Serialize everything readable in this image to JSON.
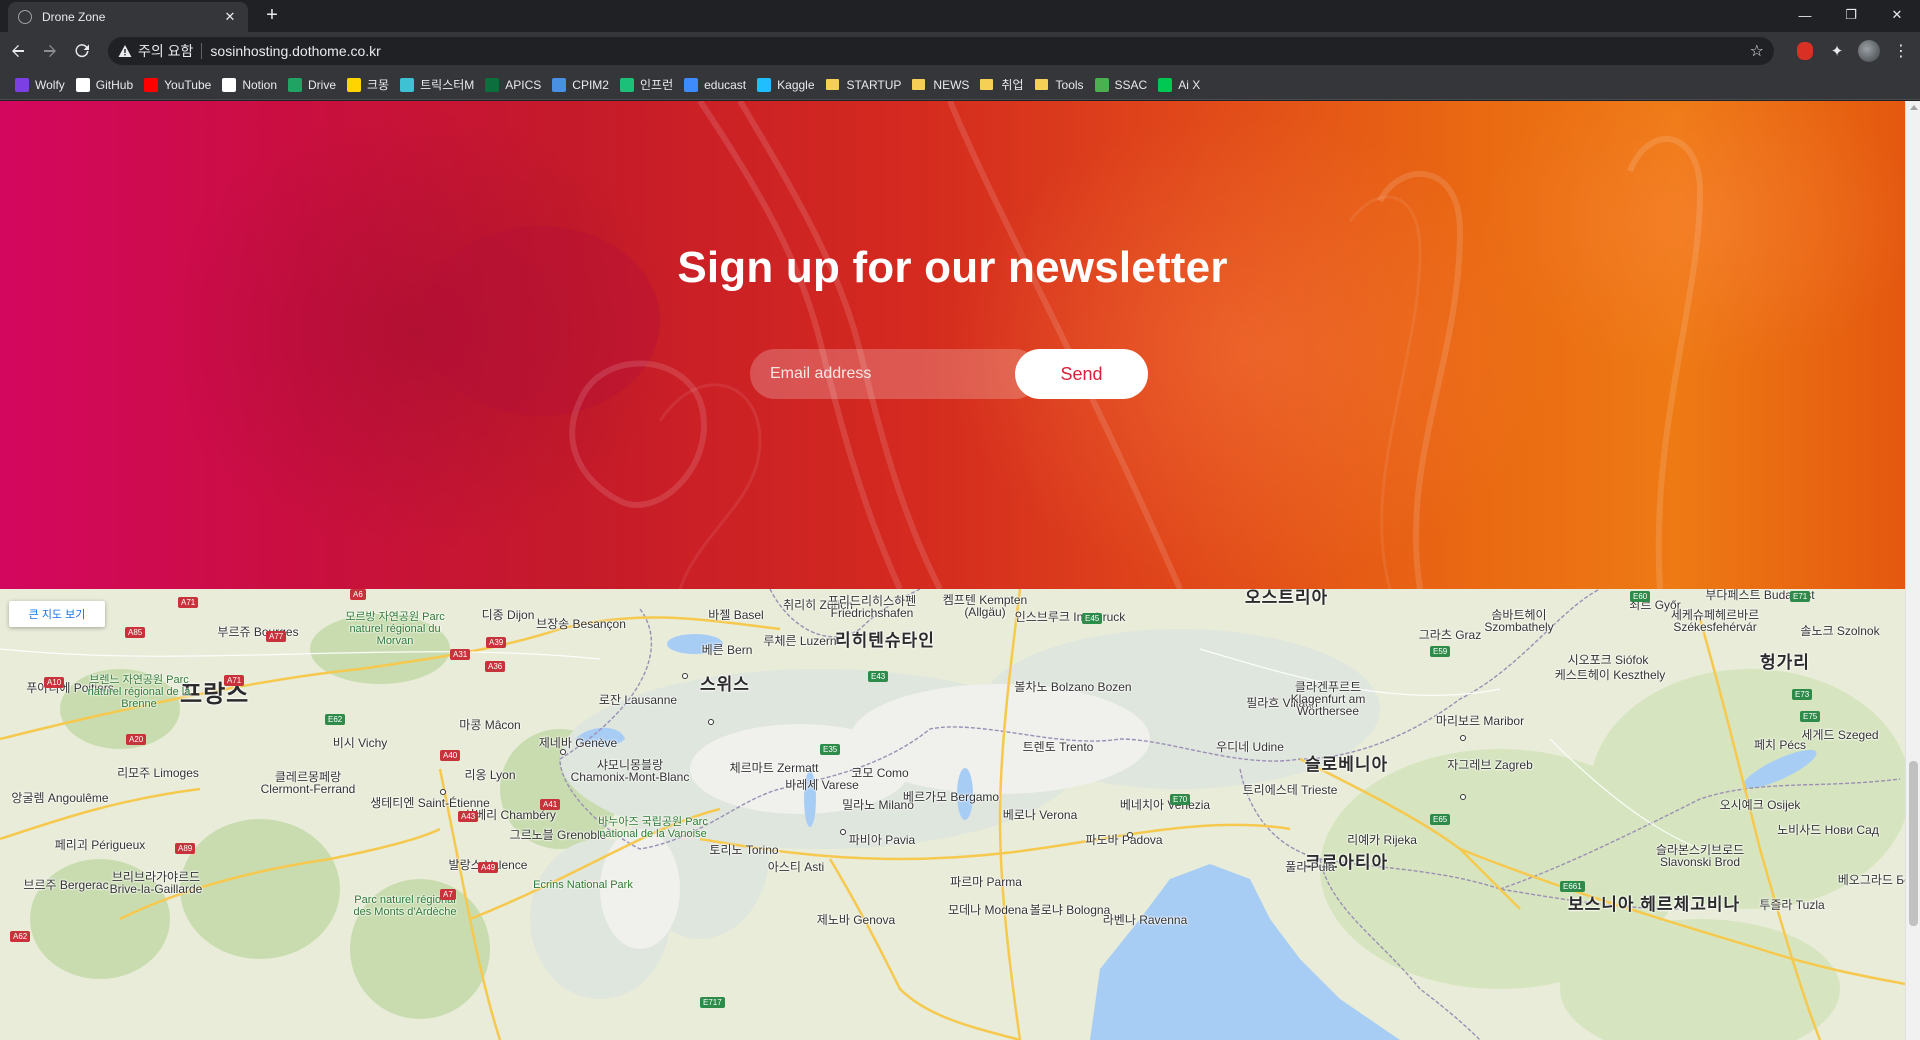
{
  "browser": {
    "tab": {
      "title": "Drone Zone",
      "close": "✕"
    },
    "new_tab": "+",
    "window_controls": {
      "minimize": "—",
      "restore": "❐",
      "close": "✕"
    },
    "security_label": "주의 요함",
    "url": "sosinhosting.dothome.co.kr",
    "bookmarks": [
      {
        "label": "Wolfy",
        "icon": "wolfy-icon",
        "color": "#7b3fe4"
      },
      {
        "label": "GitHub",
        "icon": "github-icon",
        "color": "#ffffff"
      },
      {
        "label": "YouTube",
        "icon": "youtube-icon",
        "color": "#ff0000"
      },
      {
        "label": "Notion",
        "icon": "notion-icon",
        "color": "#ffffff"
      },
      {
        "label": "Drive",
        "icon": "drive-icon",
        "color": "#1fa463"
      },
      {
        "label": "크몽",
        "icon": "kmong-icon",
        "color": "#ffd400"
      },
      {
        "label": "트릭스터M",
        "icon": "tricksterm-icon",
        "color": "#3ec1d3"
      },
      {
        "label": "APICS",
        "icon": "apics-icon",
        "color": "#0b6e3c"
      },
      {
        "label": "CPIM2",
        "icon": "cpim2-icon",
        "color": "#4a90e2"
      },
      {
        "label": "인프런",
        "icon": "inflearn-icon",
        "color": "#1dc078"
      },
      {
        "label": "educast",
        "icon": "educast-icon",
        "color": "#3d8bfd"
      },
      {
        "label": "Kaggle",
        "icon": "kaggle-icon",
        "color": "#20beff"
      },
      {
        "label": "STARTUP",
        "icon": "folder-icon",
        "color": "#f6cf57"
      },
      {
        "label": "NEWS",
        "icon": "folder-icon",
        "color": "#f6cf57"
      },
      {
        "label": "취업",
        "icon": "folder-icon",
        "color": "#f6cf57"
      },
      {
        "label": "Tools",
        "icon": "folder-icon",
        "color": "#f6cf57"
      },
      {
        "label": "SSAC",
        "icon": "ssac-icon",
        "color": "#4caf50"
      },
      {
        "label": "Ai X",
        "icon": "aix-icon",
        "color": "#00c853"
      }
    ]
  },
  "newsletter": {
    "title": "Sign up for our newsletter",
    "email_placeholder": "Email address",
    "send_label": "Send"
  },
  "map": {
    "larger_map_label": "큰 지도 보기",
    "countries": [
      {
        "name": "프랑스",
        "big": true
      },
      {
        "name": "스위스",
        "big": false
      },
      {
        "name": "오스트리아",
        "big": false
      },
      {
        "name": "헝가리",
        "big": false
      },
      {
        "name": "슬로베니아",
        "big": false
      },
      {
        "name": "크로아티아",
        "big": false
      },
      {
        "name": "보스니아 헤르체고비나",
        "big": false
      },
      {
        "name": "리히텐슈타인",
        "big": false
      }
    ],
    "cities": [
      "부르쥬 Bourges",
      "디종 Dijon",
      "브장송 Besançon",
      "바젤 Basel",
      "취리히 Zürich",
      "프리드리히스하펜 Friedrichshafen",
      "켐프텐 Kempten (Allgäu)",
      "인스브루크 Innsbruck",
      "베른 Bern",
      "루체른 Luzern",
      "로잔 Lausanne",
      "제네바 Genève",
      "리옹 Lyon",
      "리모주 Limoges",
      "푸아티에 Poitiers",
      "클레르몽페랑 Clermont-Ferrand",
      "비시 Vichy",
      "마콩 Mâcon",
      "생테티엔 Saint-Étienne",
      "그르노블 Grenoble",
      "상베리 Chambéry",
      "발랑스 Valence",
      "토리노 Torino",
      "밀라노 Milano",
      "베르가모 Bergamo",
      "코모 Como",
      "바레세 Varese",
      "파비아 Pavia",
      "아스티 Asti",
      "제노바 Genova",
      "볼차노 Bolzano Bozen",
      "트렌토 Trento",
      "베로나 Verona",
      "파도바 Padova",
      "베네치아 Venezia",
      "모데나 Modena",
      "볼로냐 Bologna",
      "파르마 Parma",
      "라벤나 Ravenna",
      "우디네 Udine",
      "트리에스테 Trieste",
      "필라흐 Villach",
      "클라겐푸르트 Klagenfurt am Wörthersee",
      "그라츠 Graz",
      "마리보르 Maribor",
      "자그레브 Zagreb",
      "리예카 Rijeka",
      "풀라 Pula",
      "부다페스트 Budapest",
      "죄르 Győr",
      "솜바트헤이 Szombathely",
      "세케슈페헤르바르 Székesfehérvár",
      "솔노크 Szolnok",
      "시오포크 Siófok",
      "케스트헤이 Keszthely",
      "페치 Pécs",
      "세게드 Szeged",
      "오시예크 Osijek",
      "노비사드 Нови Сад",
      "슬라본스키브로드 Slavonski Brod",
      "투즐라 Tuzla",
      "베오그라드 Београд",
      "브르주 Bergerac",
      "브리브라가야르드 Brive-la-Gaillarde",
      "페리괴 Périgueux",
      "앙굴렘 Angoulême",
      "샤모니몽블랑 Chamonix-Mont-Blanc",
      "체르마트 Zermatt"
    ],
    "parks": [
      "모르방 자연공원 Parc naturel régional du Morvan",
      "브렌느 자연공원 Parc naturel régional de la Brenne",
      "바누아즈 국립공원 Parc national de la Vanoise",
      "Ecrins National Park",
      "Parc naturel régional des Monts d'Ardèche"
    ],
    "road_shields": [
      "A71",
      "A6",
      "A85",
      "A77",
      "A39",
      "A31",
      "A36",
      "A10",
      "A71",
      "E62",
      "A20",
      "A40",
      "A89",
      "A43",
      "A41",
      "A49",
      "A7",
      "E717",
      "E35",
      "E43",
      "E45",
      "E70",
      "E59",
      "E71",
      "E60",
      "E73",
      "E75",
      "E65",
      "E661",
      "A62"
    ]
  }
}
